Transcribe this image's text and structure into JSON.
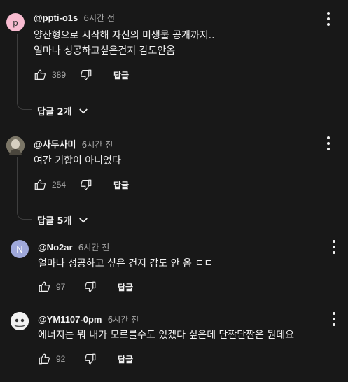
{
  "comments": [
    {
      "handle": "@ppti-o1s",
      "time": "6시간 전",
      "avatar_letter": "p",
      "avatar_color": "#f8bbd0",
      "lines": [
        "양산형으로 시작해 자신의 미생물 공개까지..",
        "얼마나 성공하고싶은건지 감도안옴"
      ],
      "likes": "389",
      "reply_label": "답글",
      "more_replies": "답글 2개"
    },
    {
      "handle": "@사두사미",
      "time": "6시간 전",
      "avatar_letter": "",
      "avatar_color": "#8a8270",
      "lines": [
        "여간 기합이 아니었다"
      ],
      "likes": "254",
      "reply_label": "답글",
      "more_replies": "답글 5개"
    },
    {
      "handle": "@No2ar",
      "time": "6시간 전",
      "avatar_letter": "N",
      "avatar_color": "#9fa8da",
      "lines": [
        "얼마나 성공하고 싶은 건지 감도 안 옴 ㄷㄷ"
      ],
      "likes": "97",
      "reply_label": "답글"
    },
    {
      "handle": "@YM1107-0pm",
      "time": "6시간 전",
      "avatar_letter": "",
      "avatar_color": "#e6e6e6",
      "lines": [
        "에너지는 뭐 내가 모르를수도 있겠다 싶은데 단짠단짠은 뭔데요"
      ],
      "likes": "92",
      "reply_label": "답글"
    }
  ],
  "icons": {
    "like": "thumb-up-icon",
    "dislike": "thumb-down-icon",
    "menu": "more-vert-icon",
    "expand": "chevron-down-icon"
  }
}
